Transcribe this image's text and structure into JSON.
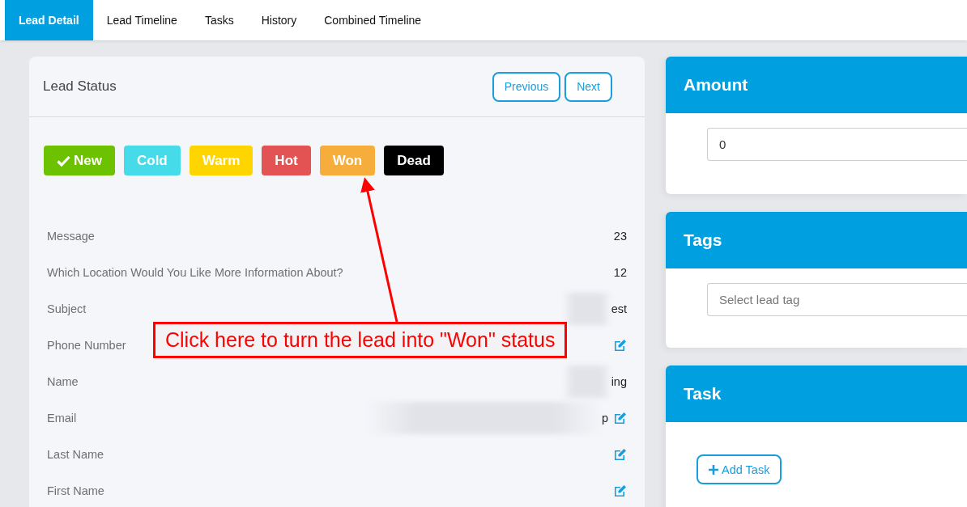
{
  "tabs": [
    {
      "label": "Lead Detail",
      "selected": true
    },
    {
      "label": "Lead Timeline",
      "selected": false
    },
    {
      "label": "Tasks",
      "selected": false
    },
    {
      "label": "History",
      "selected": false
    },
    {
      "label": "Combined Timeline",
      "selected": false
    }
  ],
  "lead_status": {
    "title": "Lead Status",
    "buttons": [
      "Previous",
      "Next"
    ],
    "statuses": [
      {
        "label": "New",
        "color": "#6cc200",
        "selected": true
      },
      {
        "label": "Cold",
        "color": "#45dbe9",
        "selected": false
      },
      {
        "label": "Warm",
        "color": "#ffd500",
        "selected": false
      },
      {
        "label": "Hot",
        "color": "#e35353",
        "selected": false
      },
      {
        "label": "Won",
        "color": "#f6ad3c",
        "selected": false
      },
      {
        "label": "Dead",
        "color": "#000000",
        "selected": false
      }
    ],
    "fields": [
      {
        "label": "Message",
        "value": "23",
        "editable": false
      },
      {
        "label": "Which Location Would You Like More Information About?",
        "value": "12",
        "editable": false
      },
      {
        "label": "Subject",
        "value": "est",
        "editable": false,
        "redacted": true
      },
      {
        "label": "Phone Number",
        "editable": true
      },
      {
        "label": "Name",
        "value": "ing",
        "editable": false,
        "redacted": true
      },
      {
        "label": "Email",
        "value": "p",
        "editable": true,
        "redacted": true
      },
      {
        "label": "Last Name",
        "editable": true
      },
      {
        "label": "First Name",
        "editable": true
      }
    ]
  },
  "amount": {
    "title": "Amount",
    "value": "0"
  },
  "tags": {
    "title": "Tags",
    "placeholder": "Select lead tag"
  },
  "task": {
    "title": "Task",
    "button": "Add Task"
  },
  "annotation": {
    "text": "Click here to turn the lead into \"Won\" status"
  }
}
